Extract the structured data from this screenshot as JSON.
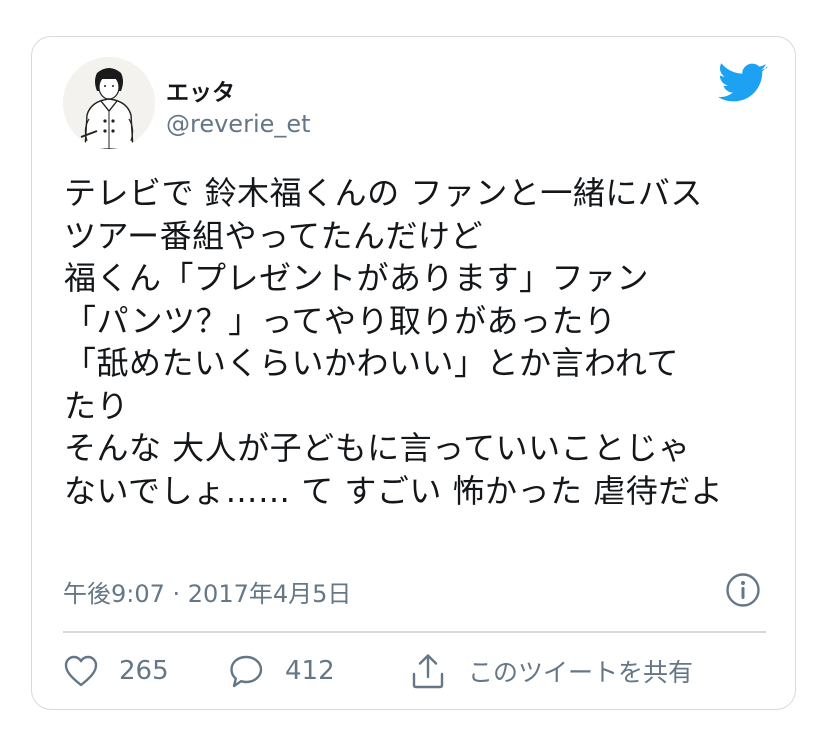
{
  "user": {
    "name": "エッタ",
    "handle": "@reverie_et"
  },
  "tweet": {
    "lines": [
      "テレビで 鈴木福くんの ファンと一緒にバス",
      "ツアー番組やってたんだけど",
      "福くん「プレゼントがあります」ファン",
      "「パンツ？」ってやり取りがあったり",
      "「舐めたいくらいかわいい」とか言われて",
      "たり",
      "そんな 大人が子どもに言っていいことじゃ",
      "ないでしょ…… て すごい 怖かった 虐待だよ"
    ],
    "timestamp": "午後9:07 · 2017年4月5日"
  },
  "actions": {
    "like_count": "265",
    "reply_count": "412",
    "share_label": "このツイートを共有"
  },
  "icons": {
    "logo": "twitter-bird-icon",
    "info": "info-icon",
    "like": "heart-icon",
    "reply": "comment-icon",
    "share": "share-icon"
  },
  "colors": {
    "brand": "#1da1f2",
    "text": "#14171a",
    "muted": "#657786",
    "border": "#d6dadd"
  }
}
